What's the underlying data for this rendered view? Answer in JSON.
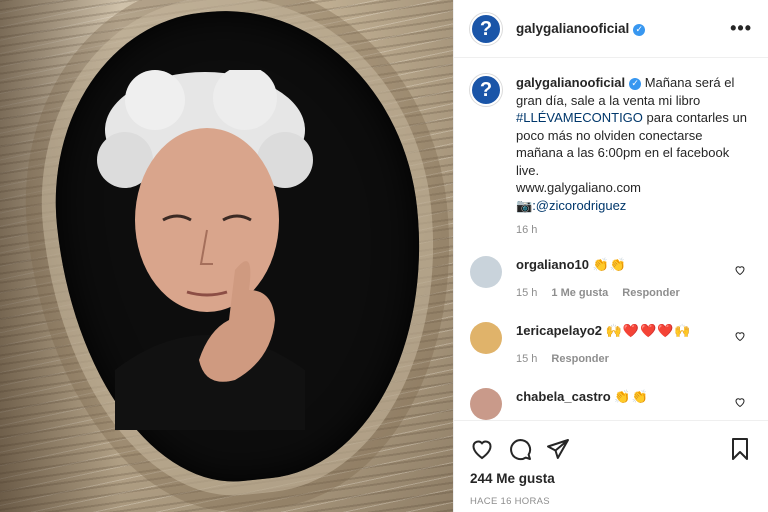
{
  "post": {
    "username": "galygalianooficial",
    "avatar_letter": "?",
    "more_label": "•••",
    "caption": {
      "text_part1": "Mañana será el gran día, sale a la venta mi libro ",
      "hashtag": "#LLÉVAMECONTIGO",
      "text_part2": " para contarles un poco más no olviden conectarse mañana a las 6:00pm en el facebook live.",
      "website": "www.galygaliano.com",
      "camera_emoji": "📷",
      "credit": ":@zicorodriguez",
      "time": "16 h"
    },
    "comments": [
      {
        "username": "orgaliano10",
        "text": "👏👏",
        "time": "15 h",
        "likes": "1 Me gusta",
        "reply": "Responder",
        "avatar_color": "#c9d3db"
      },
      {
        "username": "1ericapelayo2",
        "text": "🙌❤️❤️❤️🙌",
        "time": "15 h",
        "likes": "",
        "reply": "Responder",
        "avatar_color": "#e0b36a"
      },
      {
        "username": "chabela_castro",
        "text": "👏👏",
        "time": "",
        "likes": "",
        "reply": "",
        "avatar_color": "#c99a8a"
      }
    ],
    "likes_count": "244 Me gusta",
    "posted_ago": "HACE 16 HORAS"
  },
  "colors": {
    "verified": "#3897f0",
    "avatar_bg": "#1a55a8",
    "link": "#00376b",
    "muted": "#8e8e8e"
  }
}
